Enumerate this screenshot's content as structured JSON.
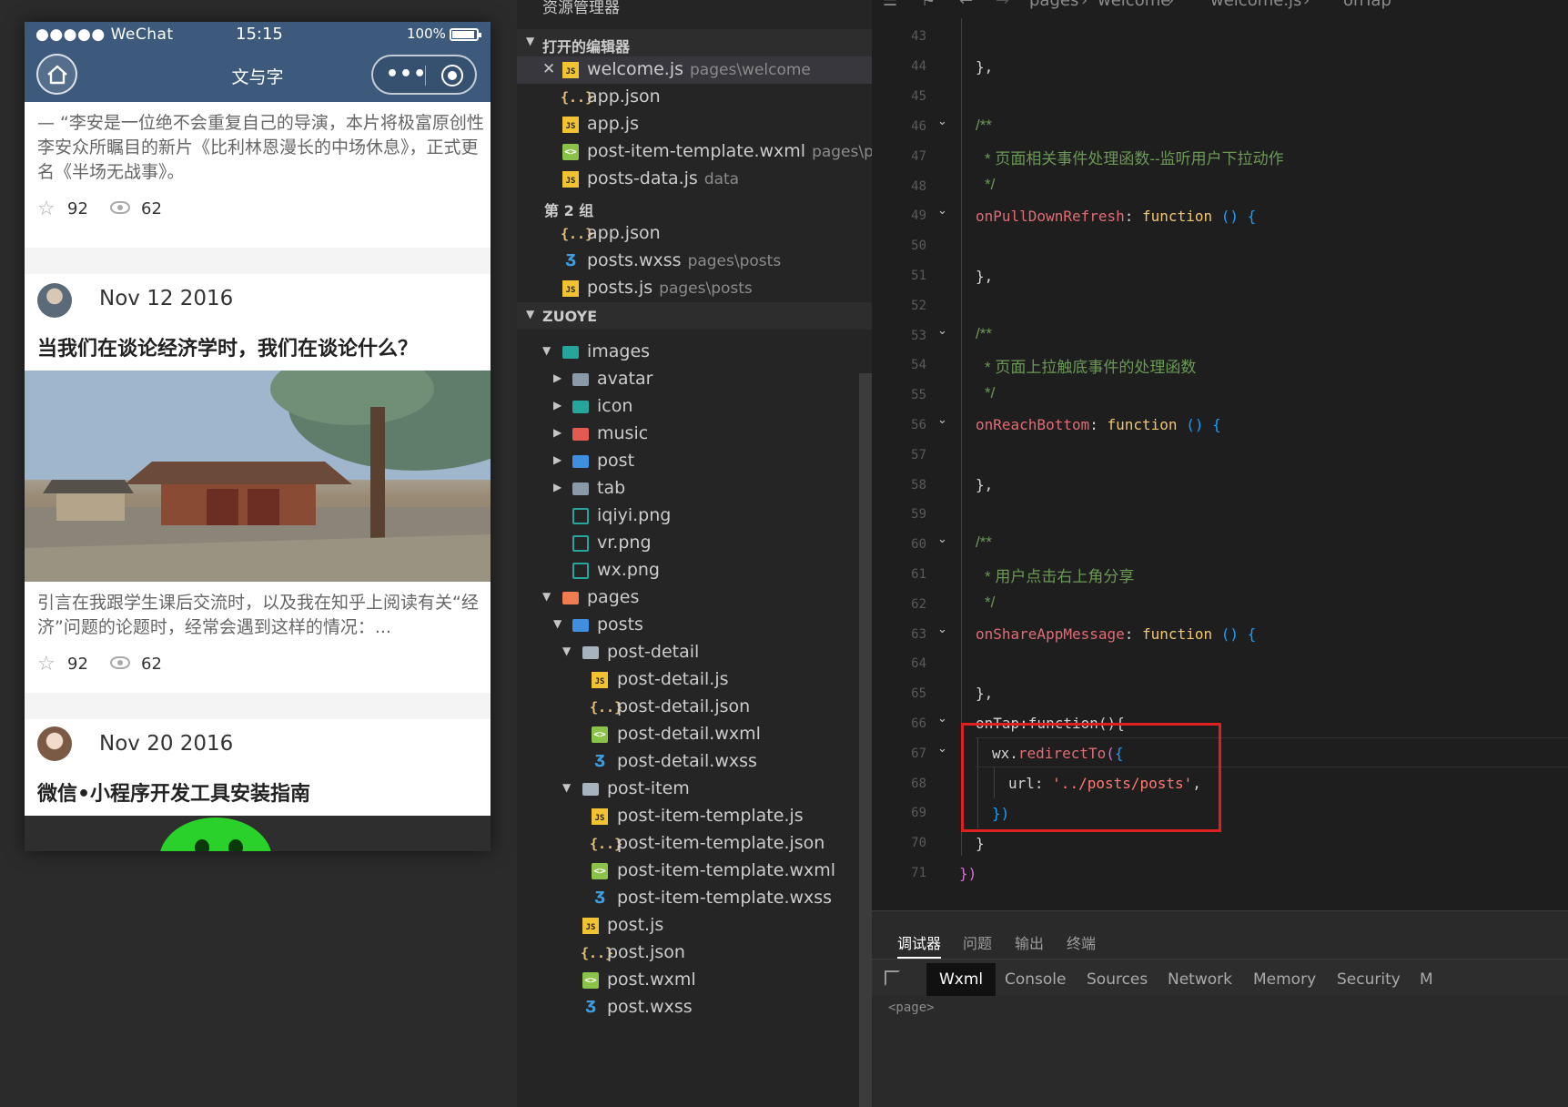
{
  "phone": {
    "status": {
      "carrier": "●●●●● WeChat",
      "time": "15:15",
      "battery": "100%"
    },
    "nav": {
      "title": "文与字"
    },
    "feed": {
      "card1": {
        "excerpt": "— “李安是一位绝不会重复自己的导演，本片将极富原创性李安众所瞩目的新片《比利林恩漫长的中场休息》，正式更名《半场无战事》。",
        "likes": "92",
        "views": "62"
      },
      "card2": {
        "date": "Nov 12 2016",
        "title": "当我们在谈论经济学时，我们在谈论什么？",
        "excerpt": "引言在我跟学生课后交流时，以及我在知乎上阅读有关“经济”问题的论题时，经常会遇到这样的情况：...",
        "likes": "92",
        "views": "62"
      },
      "card3": {
        "date": "Nov 20 2016",
        "title": "微信•小程序开发工具安装指南"
      }
    }
  },
  "explorer": {
    "title": "资源管理器",
    "open_editors_header": "打开的编辑器",
    "open_editors": [
      {
        "name": "welcome.js",
        "path": "pages\\welcome"
      },
      {
        "name": "app.json",
        "path": ""
      },
      {
        "name": "app.js",
        "path": ""
      },
      {
        "name": "post-item-template.wxml",
        "path": "pages\\po..."
      },
      {
        "name": "posts-data.js",
        "path": "data"
      }
    ],
    "group2_label": "第 2 组",
    "group2": [
      {
        "name": "app.json",
        "path": ""
      },
      {
        "name": "posts.wxss",
        "path": "pages\\posts"
      },
      {
        "name": "posts.js",
        "path": "pages\\posts"
      }
    ],
    "project_header": "ZUOYE",
    "tree": [
      "images",
      "avatar",
      "icon",
      "music",
      "post",
      "tab",
      "iqiyi.png",
      "vr.png",
      "wx.png",
      "pages",
      "posts",
      "post-detail",
      "post-detail.js",
      "post-detail.json",
      "post-detail.wxml",
      "post-detail.wxss",
      "post-item",
      "post-item-template.js",
      "post-item-template.json",
      "post-item-template.wxml",
      "post-item-template.wxss",
      "post.js",
      "post.json",
      "post.wxml",
      "post.wxss"
    ]
  },
  "editor": {
    "breadcrumb": [
      "pages",
      "welcome",
      "welcome.js",
      "onTap"
    ],
    "lines": {
      "43": "",
      "44": "},",
      "45": "",
      "46": "/**",
      "47": "* 页面相关事件处理函数--监听用户下拉动作",
      "48": "*/",
      "49a": "onPullDownRefresh",
      "49b": "function",
      "50": "",
      "51": "},",
      "52": "",
      "53": "/**",
      "54": "* 页面上拉触底事件的处理函数",
      "55": "*/",
      "56a": "onReachBottom",
      "56b": "function",
      "57": "",
      "58": "},",
      "59": "",
      "60": "/**",
      "61": "* 用户点击右上角分享",
      "62": "*/",
      "63a": "onShareAppMessage",
      "63b": "function",
      "64": "",
      "65": "},",
      "66": "onTap:function(){",
      "67a": "wx.",
      "67b": "redirectTo",
      "68a": "url",
      "68b": "'../posts/posts'",
      "69": "})",
      "70": "}",
      "71": "})"
    },
    "line_numbers": [
      "43",
      "44",
      "45",
      "46",
      "47",
      "48",
      "49",
      "50",
      "51",
      "52",
      "53",
      "54",
      "55",
      "56",
      "57",
      "58",
      "59",
      "60",
      "61",
      "62",
      "63",
      "64",
      "65",
      "66",
      "67",
      "68",
      "69",
      "70",
      "71"
    ]
  },
  "devtools": {
    "top_tabs": [
      "调试器",
      "问题",
      "输出",
      "终端"
    ],
    "panel_tabs": [
      "Wxml",
      "Console",
      "Sources",
      "Network",
      "Memory",
      "Security",
      "M"
    ],
    "content": "<page>"
  },
  "colors": {
    "nav_blue": "#3d5a7c",
    "highlight_red": "#e0201e",
    "editor_bg": "#1e1e1e"
  }
}
